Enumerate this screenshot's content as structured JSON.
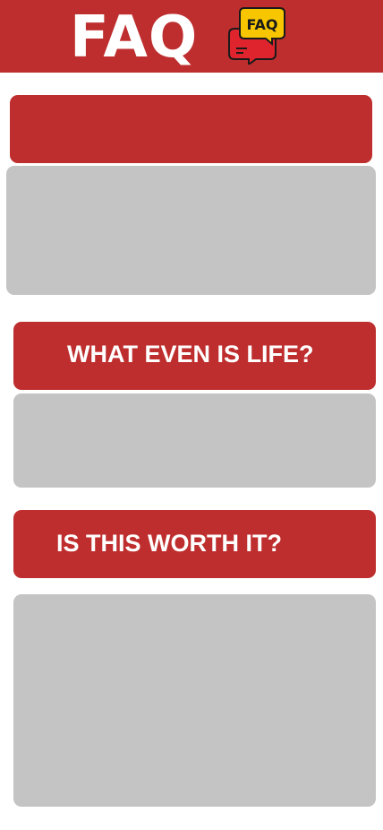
{
  "header": {
    "title": "FAQ",
    "icon_text": "FAQ",
    "icon_name": "faq-speech-bubbles-icon"
  },
  "faqs": [
    {
      "question": "",
      "answer": ""
    },
    {
      "question": "WHAT EVEN IS LIFE?",
      "answer": ""
    },
    {
      "question": "IS THIS WORTH IT?",
      "answer": ""
    }
  ],
  "colors": {
    "accent": "#bf2e2e",
    "answer_bg": "#c4c4c4",
    "text_on_accent": "#ffffff",
    "icon_yellow": "#f7c600",
    "icon_red": "#e0242e"
  }
}
